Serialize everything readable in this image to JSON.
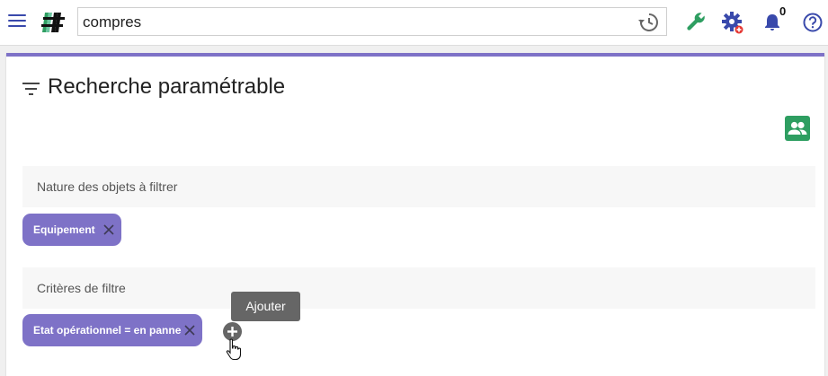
{
  "topbar": {
    "search_value": "compres",
    "notification_count": "0"
  },
  "icons": {
    "menu": "hamburger-icon",
    "logo": "hash-logo",
    "history": "history-icon",
    "tools": "wrench-icon",
    "settings": "gear-icon",
    "notifications": "bell-icon",
    "help": "help-icon",
    "filter": "filter-list-icon",
    "group": "group-icon",
    "remove": "close-icon",
    "add": "plus-circle-icon",
    "cursor": "hand-pointer-icon"
  },
  "page": {
    "title": "Recherche paramétrable"
  },
  "sections": {
    "nature": {
      "label": "Nature des objets à filtrer",
      "chips": [
        "Equipement"
      ]
    },
    "criteria": {
      "label": "Critères de filtre",
      "chips": [
        "Etat opérationnel = en panne"
      ],
      "add_tooltip": "Ajouter"
    }
  },
  "colors": {
    "accent": "#7e72c7",
    "primary_icon": "#3949ab",
    "tools_green": "#2e9e61",
    "group_button": "#2e9e61",
    "tooltip_bg": "#666666"
  }
}
